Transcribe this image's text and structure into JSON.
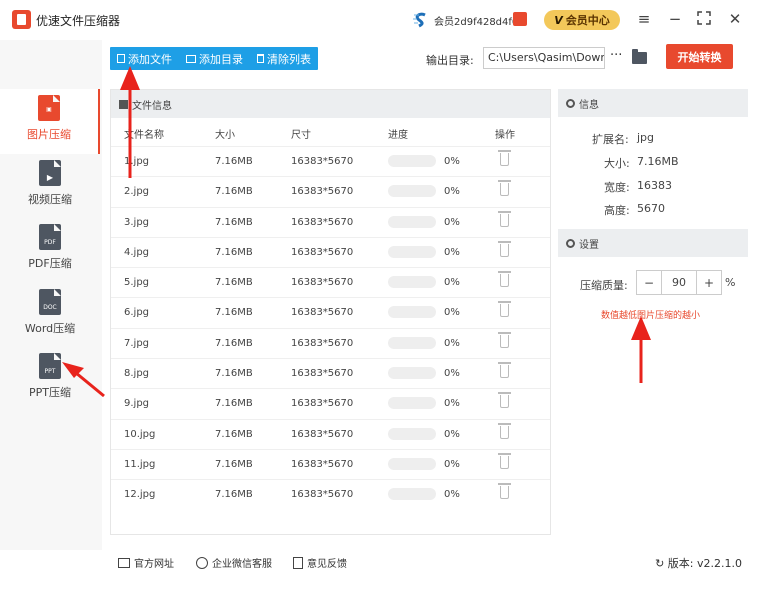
{
  "app": {
    "title": "优速文件压缩器",
    "member_id": "会员2d9f428d4f0b",
    "vip_label": "会员中心",
    "vip_k": "V"
  },
  "sidebar": {
    "items": [
      {
        "label": "图片压缩",
        "icon": "image-doc-icon",
        "active": true,
        "tag": ""
      },
      {
        "label": "视频压缩",
        "icon": "video-doc-icon",
        "active": false,
        "tag": "▶"
      },
      {
        "label": "PDF压缩",
        "icon": "pdf-doc-icon",
        "active": false,
        "tag": "PDF"
      },
      {
        "label": "Word压缩",
        "icon": "word-doc-icon",
        "active": false,
        "tag": "DOC"
      },
      {
        "label": "PPT压缩",
        "icon": "ppt-doc-icon",
        "active": false,
        "tag": "PPT"
      }
    ]
  },
  "toolbar": {
    "add_file": "添加文件",
    "add_dir": "添加目录",
    "clear_list": "清除列表",
    "output_label": "输出目录:",
    "output_path": "C:\\Users\\Qasim\\Downlo",
    "more": "···",
    "start": "开始转换"
  },
  "file_panel": {
    "title": "文件信息",
    "columns": [
      "文件名称",
      "大小",
      "尺寸",
      "进度",
      "操作"
    ],
    "rows": [
      {
        "name": "1.jpg",
        "size": "7.16MB",
        "dim": "16383*5670",
        "progress": "0%"
      },
      {
        "name": "2.jpg",
        "size": "7.16MB",
        "dim": "16383*5670",
        "progress": "0%"
      },
      {
        "name": "3.jpg",
        "size": "7.16MB",
        "dim": "16383*5670",
        "progress": "0%"
      },
      {
        "name": "4.jpg",
        "size": "7.16MB",
        "dim": "16383*5670",
        "progress": "0%"
      },
      {
        "name": "5.jpg",
        "size": "7.16MB",
        "dim": "16383*5670",
        "progress": "0%"
      },
      {
        "name": "6.jpg",
        "size": "7.16MB",
        "dim": "16383*5670",
        "progress": "0%"
      },
      {
        "name": "7.jpg",
        "size": "7.16MB",
        "dim": "16383*5670",
        "progress": "0%"
      },
      {
        "name": "8.jpg",
        "size": "7.16MB",
        "dim": "16383*5670",
        "progress": "0%"
      },
      {
        "name": "9.jpg",
        "size": "7.16MB",
        "dim": "16383*5670",
        "progress": "0%"
      },
      {
        "name": "10.jpg",
        "size": "7.16MB",
        "dim": "16383*5670",
        "progress": "0%"
      },
      {
        "name": "11.jpg",
        "size": "7.16MB",
        "dim": "16383*5670",
        "progress": "0%"
      },
      {
        "name": "12.jpg",
        "size": "7.16MB",
        "dim": "16383*5670",
        "progress": "0%"
      }
    ]
  },
  "info": {
    "title": "信息",
    "ext_label": "扩展名:",
    "ext": "jpg",
    "size_label": "大小:",
    "size": "7.16MB",
    "width_label": "宽度:",
    "width": "16383",
    "height_label": "高度:",
    "height": "5670"
  },
  "settings": {
    "title": "设置",
    "quality_label": "压缩质量:",
    "quality": "90",
    "minus": "−",
    "plus": "+",
    "unit": "%",
    "hint": "数值越低图片压缩的越小"
  },
  "footer": {
    "website": "官方网址",
    "wechat": "企业微信客服",
    "feedback": "意见反馈",
    "version": "版本: v2.2.1.0"
  },
  "colors": {
    "accent": "#e8492e",
    "toolbar_blue": "#1e9fe6",
    "vip_gold": "#f3c85a"
  }
}
